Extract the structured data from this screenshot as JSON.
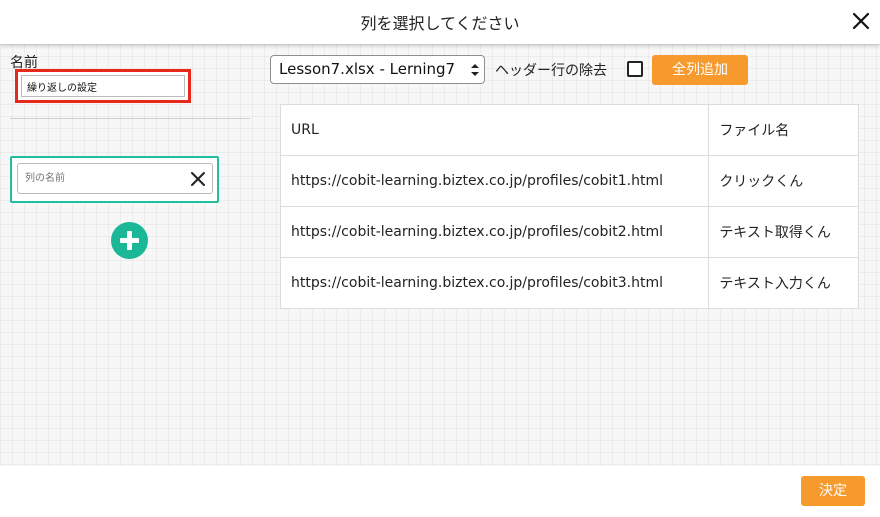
{
  "dialog": {
    "title": "列を選択してください"
  },
  "left": {
    "name_label": "名前",
    "name_value": "繰り返しの設定",
    "column_placeholder": "列の名前"
  },
  "toolbar": {
    "sheet_selected": "Lesson7.xlsx - Lerning7",
    "header_exclude_label": "ヘッダー行の除去",
    "header_exclude_checked": false,
    "add_all_label": "全列追加"
  },
  "table": {
    "columns": [
      "URL",
      "ファイル名"
    ],
    "rows": [
      [
        "https://cobit-learning.biztex.co.jp/profiles/cobit1.html",
        "クリックくん"
      ],
      [
        "https://cobit-learning.biztex.co.jp/profiles/cobit2.html",
        "テキスト取得くん"
      ],
      [
        "https://cobit-learning.biztex.co.jp/profiles/cobit3.html",
        "テキスト入力くん"
      ]
    ]
  },
  "footer": {
    "ok_label": "決定"
  },
  "colors": {
    "accent_orange": "#f79a2e",
    "accent_green": "#1ab897",
    "highlight_red": "#e8281d"
  }
}
